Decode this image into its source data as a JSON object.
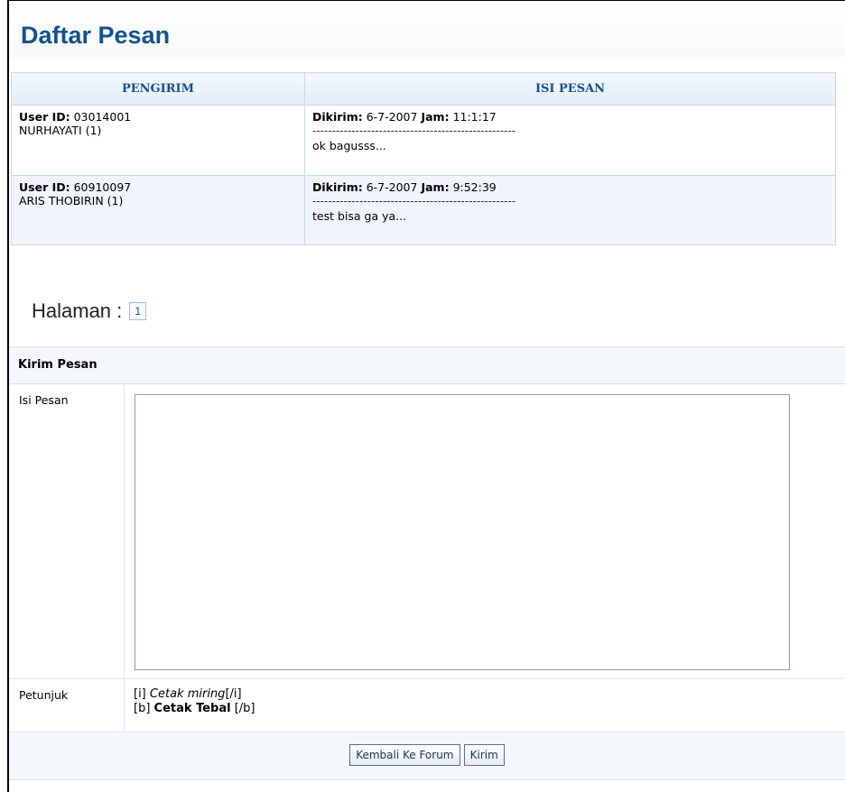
{
  "title": "Daftar Pesan",
  "table": {
    "headers": [
      "PENGIRIM",
      "ISI PESAN"
    ],
    "rows": [
      {
        "user_id_label": "User ID:",
        "user_id": "03014001",
        "sender_name": "NURHAYATI (1)",
        "sent_label": "Dikirim:",
        "sent_date": "6-7-2007",
        "time_label": "Jam:",
        "sent_time": "11:1:17",
        "separator": "----------------------------------------------------",
        "message": "ok bagusss..."
      },
      {
        "user_id_label": "User ID:",
        "user_id": "60910097",
        "sender_name": "ARIS THOBIRIN (1)",
        "sent_label": "Dikirim:",
        "sent_date": "6-7-2007",
        "time_label": "Jam:",
        "sent_time": "9:52:39",
        "separator": "----------------------------------------------------",
        "message": "test bisa ga ya..."
      }
    ]
  },
  "pagination": {
    "label": "Halaman :",
    "current": "1"
  },
  "form": {
    "heading": "Kirim Pesan",
    "message_label": "Isi Pesan",
    "message_value": "",
    "hint_label": "Petunjuk",
    "hint_italic_open": "[i]",
    "hint_italic_text": "Cetak miring",
    "hint_italic_close": "[/i]",
    "hint_bold_open": "[b]",
    "hint_bold_text": "Cetak Tebal",
    "hint_bold_close": "[/b]",
    "back_button": "Kembali Ke Forum",
    "send_button": "Kirim"
  },
  "colors": {
    "accent": "#14518f",
    "header_bg": "#e2ecf7",
    "row_alt": "#f0f5fb"
  }
}
